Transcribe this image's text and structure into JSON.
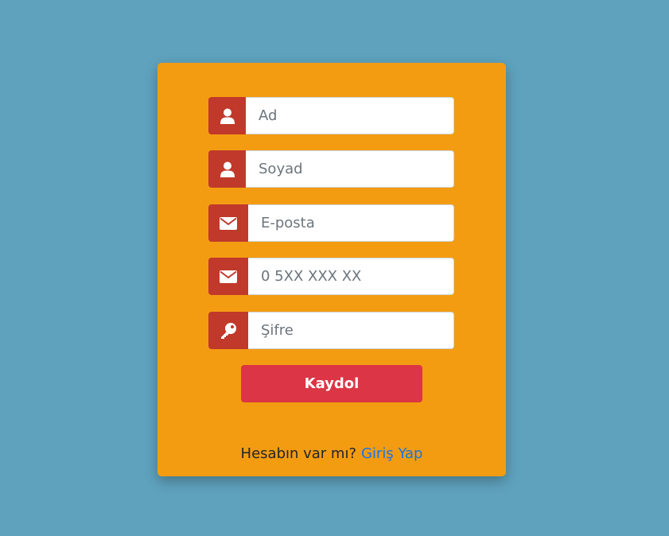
{
  "form": {
    "fields": [
      {
        "placeholder": "Ad",
        "icon": "user-icon"
      },
      {
        "placeholder": "Soyad",
        "icon": "user-icon"
      },
      {
        "placeholder": "E-posta",
        "icon": "envelope-icon"
      },
      {
        "placeholder": "0 5XX XXX XX",
        "icon": "envelope-icon"
      },
      {
        "placeholder": "Şifre",
        "icon": "key-icon"
      }
    ],
    "submit_label": "Kaydol",
    "footer_text": "Hesabın var mı?",
    "login_link": "Giriş Yap"
  },
  "colors": {
    "background": "#5fa2bd",
    "card": "#f39c12",
    "icon_box": "#c0392b",
    "button": "#dc3545",
    "link": "#1a73e8"
  }
}
